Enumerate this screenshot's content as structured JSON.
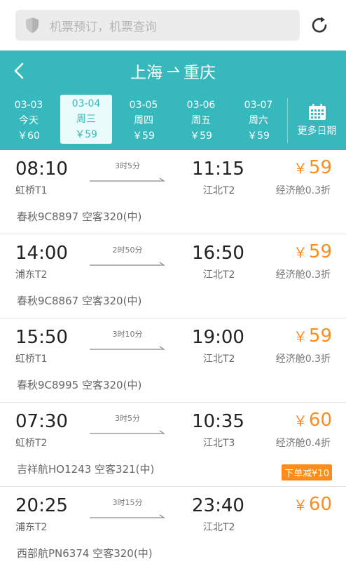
{
  "search": {
    "placeholder": "机票预订，机票查询"
  },
  "header": {
    "origin": "上海",
    "destination": "重庆"
  },
  "dates": [
    {
      "date": "03-03",
      "day": "今天",
      "price": "￥60",
      "selected": false
    },
    {
      "date": "03-04",
      "day": "周三",
      "price": "￥59",
      "selected": true
    },
    {
      "date": "03-05",
      "day": "周四",
      "price": "￥59",
      "selected": false
    },
    {
      "date": "03-06",
      "day": "周五",
      "price": "￥59",
      "selected": false
    },
    {
      "date": "03-07",
      "day": "周六",
      "price": "￥59",
      "selected": false
    }
  ],
  "more_dates_label": "更多日期",
  "flights": [
    {
      "dep_time": "08:10",
      "dep_airport": "虹桥T1",
      "duration": "3时5分",
      "arr_time": "11:15",
      "arr_airport": "江北T2",
      "currency": "￥",
      "price": "59",
      "cabin": "经济舱0.3折",
      "airline": "春秋9C8897 空客320(中)",
      "badge": ""
    },
    {
      "dep_time": "14:00",
      "dep_airport": "浦东T2",
      "duration": "2时50分",
      "arr_time": "16:50",
      "arr_airport": "江北T2",
      "currency": "￥",
      "price": "59",
      "cabin": "经济舱0.3折",
      "airline": "春秋9C8867 空客320(中)",
      "badge": ""
    },
    {
      "dep_time": "15:50",
      "dep_airport": "虹桥T1",
      "duration": "3时10分",
      "arr_time": "19:00",
      "arr_airport": "江北T2",
      "currency": "￥",
      "price": "59",
      "cabin": "经济舱0.3折",
      "airline": "春秋9C8995 空客320(中)",
      "badge": ""
    },
    {
      "dep_time": "07:30",
      "dep_airport": "虹桥T2",
      "duration": "3时5分",
      "arr_time": "10:35",
      "arr_airport": "江北T3",
      "currency": "￥",
      "price": "60",
      "cabin": "经济舱0.4折",
      "airline": "吉祥航HO1243 空客321(中)",
      "badge": "下单减¥10"
    },
    {
      "dep_time": "20:25",
      "dep_airport": "浦东T2",
      "duration": "3时15分",
      "arr_time": "23:40",
      "arr_airport": "江北T2",
      "currency": "￥",
      "price": "60",
      "cabin": "",
      "airline": "西部航PN6374 空客320(中)",
      "badge": ""
    }
  ],
  "colors": {
    "accent": "#36b8bd",
    "price": "#ff8c1a",
    "selected_bg": "#e9fbfb"
  },
  "icons": {
    "search": "shield-icon",
    "refresh": "refresh-icon",
    "back": "back-arrow-icon",
    "calendar": "calendar-icon"
  }
}
